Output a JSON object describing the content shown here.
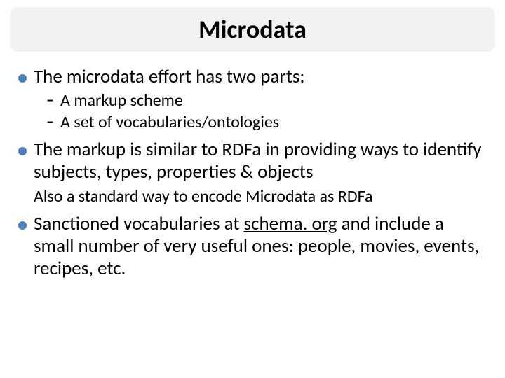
{
  "title": "Microdata",
  "bullets": [
    {
      "text": "The microdata effort has two parts:",
      "sub": [
        "A markup scheme",
        "A set of vocabularies/ontologies"
      ]
    },
    {
      "text": "The markup is similar to RDFa in providing ways to identify subjects, types, properties & objects",
      "subtext": "Also a standard way to encode Microdata as RDFa"
    },
    {
      "text_a": "Sanctioned vocabularies at ",
      "link": "schema. org",
      "text_b": " and include a small number of very useful ones: people, movies, events, recipes, etc."
    }
  ]
}
